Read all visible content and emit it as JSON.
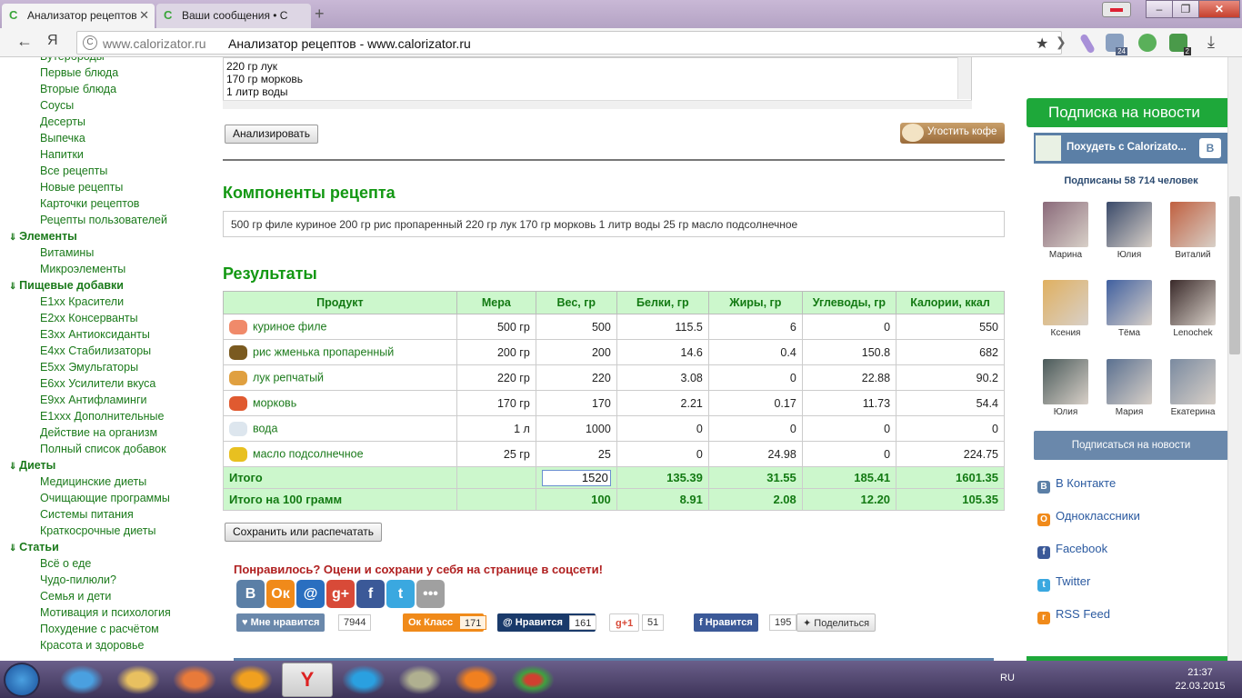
{
  "browser": {
    "tabs": [
      {
        "label": "Анализатор рецептов",
        "active": true
      },
      {
        "label": "Ваши сообщения • С",
        "active": false
      }
    ],
    "new_tab": "+",
    "back": "←",
    "yandex": "Я",
    "url": "www.calorizator.ru",
    "page_title": "Анализатор рецептов - www.calorizator.ru",
    "ext_badges": [
      "24",
      "2"
    ]
  },
  "sidebar": {
    "items": [
      {
        "label": "Бутерброды",
        "header": false
      },
      {
        "label": "Первые блюда",
        "header": false
      },
      {
        "label": "Вторые блюда",
        "header": false
      },
      {
        "label": "Соусы",
        "header": false
      },
      {
        "label": "Десерты",
        "header": false
      },
      {
        "label": "Выпечка",
        "header": false
      },
      {
        "label": "Напитки",
        "header": false
      },
      {
        "label": "Все рецепты",
        "header": false
      },
      {
        "label": "Новые рецепты",
        "header": false
      },
      {
        "label": "Карточки рецептов",
        "header": false
      },
      {
        "label": "Рецепты пользователей",
        "header": false
      },
      {
        "label": "Элементы",
        "header": true
      },
      {
        "label": "Витамины",
        "header": false
      },
      {
        "label": "Микроэлементы",
        "header": false
      },
      {
        "label": "Пищевые добавки",
        "header": true
      },
      {
        "label": "E1xx Красители",
        "header": false
      },
      {
        "label": "E2xx Консерванты",
        "header": false
      },
      {
        "label": "E3xx Антиоксиданты",
        "header": false
      },
      {
        "label": "E4xx Стабилизаторы",
        "header": false
      },
      {
        "label": "E5xx Эмульгаторы",
        "header": false
      },
      {
        "label": "E6xx Усилители вкуса",
        "header": false
      },
      {
        "label": "E9xx Антифламинги",
        "header": false
      },
      {
        "label": "E1xxx Дополнительные",
        "header": false
      },
      {
        "label": "Действие на организм",
        "header": false
      },
      {
        "label": "Полный список добавок",
        "header": false
      },
      {
        "label": "Диеты",
        "header": true
      },
      {
        "label": "Медицинские диеты",
        "header": false
      },
      {
        "label": "Очищающие программы",
        "header": false
      },
      {
        "label": "Системы питания",
        "header": false
      },
      {
        "label": "Краткосрочные диеты",
        "header": false
      },
      {
        "label": "Статьи",
        "header": true
      },
      {
        "label": "Всё о еде",
        "header": false
      },
      {
        "label": "Чудо-пилюли?",
        "header": false
      },
      {
        "label": "Семья и дети",
        "header": false
      },
      {
        "label": "Мотивация и психология",
        "header": false
      },
      {
        "label": "Похудение с расчётом",
        "header": false
      },
      {
        "label": "Красота и здоровье",
        "header": false
      }
    ]
  },
  "recipe_input": {
    "lines": [
      "220 гр лук",
      "170 гр морковь",
      "1 литр воды"
    ]
  },
  "buttons": {
    "analyze": "Анализировать",
    "coffee": "Угостить кофе",
    "save_print": "Сохранить или распечатать"
  },
  "components": {
    "heading": "Компоненты рецепта",
    "text": "500 гр филе куриное 200 гр рис пропаренный 220 гр лук 170 гр морковь 1 литр воды 25 гр масло подсолнечное"
  },
  "results": {
    "heading": "Результаты",
    "columns": [
      "Продукт",
      "Мера",
      "Вес, гр",
      "Белки, гр",
      "Жиры, гр",
      "Углеводы, гр",
      "Калории, ккал"
    ],
    "rows": [
      {
        "product": "куриное филе",
        "measure": "500 гр",
        "weight": "500",
        "protein": "115.5",
        "fat": "6",
        "carbs": "0",
        "kcal": "550",
        "icon_color": "#f08a6a"
      },
      {
        "product": "рис жменька пропаренный",
        "measure": "200 гр",
        "weight": "200",
        "protein": "14.6",
        "fat": "0.4",
        "carbs": "150.8",
        "kcal": "682",
        "icon_color": "#7a5a20"
      },
      {
        "product": "лук репчатый",
        "measure": "220 гр",
        "weight": "220",
        "protein": "3.08",
        "fat": "0",
        "carbs": "22.88",
        "kcal": "90.2",
        "icon_color": "#e0a040"
      },
      {
        "product": "морковь",
        "measure": "170 гр",
        "weight": "170",
        "protein": "2.21",
        "fat": "0.17",
        "carbs": "11.73",
        "kcal": "54.4",
        "icon_color": "#e05a30"
      },
      {
        "product": "вода",
        "measure": "1 л",
        "weight": "1000",
        "protein": "0",
        "fat": "0",
        "carbs": "0",
        "kcal": "0",
        "icon_color": "#dde6ee"
      },
      {
        "product": "масло подсолнечное",
        "measure": "25 гр",
        "weight": "25",
        "protein": "0",
        "fat": "24.98",
        "carbs": "0",
        "kcal": "224.75",
        "icon_color": "#e8c020"
      }
    ],
    "total": {
      "label": "Итого",
      "weight": "1520",
      "protein": "135.39",
      "fat": "31.55",
      "carbs": "185.41",
      "kcal": "1601.35"
    },
    "per100": {
      "label": "Итого на 100 грамм",
      "weight": "100",
      "protein": "8.91",
      "fat": "2.08",
      "carbs": "12.20",
      "kcal": "105.35"
    }
  },
  "share": {
    "prompt": "Понравилось? Оцени и сохрани у себя на странице в соцсети!",
    "icons": [
      {
        "glyph": "В",
        "color": "#5b7fa6"
      },
      {
        "glyph": "Ок",
        "color": "#f08a1a"
      },
      {
        "glyph": "@",
        "color": "#2a6fc0"
      },
      {
        "glyph": "g+",
        "color": "#d84a38"
      },
      {
        "glyph": "f",
        "color": "#3b5998"
      },
      {
        "glyph": "t",
        "color": "#3aa8e0"
      },
      {
        "glyph": "•••",
        "color": "#a0a0a0"
      }
    ],
    "vk_like": "Мне нравится",
    "vk_count": "7944",
    "ok_label": "Класс",
    "ok_count": "171",
    "mail_label": "Нравится",
    "mail_count": "161",
    "gplus_label": "+1",
    "gplus_count": "51",
    "fb_label": "Нравится",
    "fb_count": "195",
    "share_label": "Поделиться"
  },
  "right": {
    "subscribe_title": "Подписка на новости",
    "vk_group": "Похудеть с Calorizato...",
    "vk_logo": "В",
    "subscribers": "Подписаны 58 714 человек",
    "members": [
      {
        "name": "Марина",
        "color": "#8a6a7a"
      },
      {
        "name": "Юлия",
        "color": "#3a4a6a"
      },
      {
        "name": "Виталий",
        "color": "#c06040"
      },
      {
        "name": "Ксения",
        "color": "#e0b060"
      },
      {
        "name": "Тёма",
        "color": "#4060a0"
      },
      {
        "name": "Lenochek",
        "color": "#3a2a2a"
      },
      {
        "name": "Юлия",
        "color": "#4a5a5a"
      },
      {
        "name": "Мария",
        "color": "#5a7090"
      },
      {
        "name": "Екатерина",
        "color": "#7a8aa0"
      }
    ],
    "subscribe_btn": "Подписаться на новости",
    "links": [
      {
        "label": "В Контакте",
        "glyph": "В",
        "color": "#5b7fa6"
      },
      {
        "label": "Одноклассники",
        "glyph": "О",
        "color": "#f08a1a"
      },
      {
        "label": "Facebook",
        "glyph": "f",
        "color": "#3b5998"
      },
      {
        "label": "Twitter",
        "glyph": "t",
        "color": "#3aa8e0"
      },
      {
        "label": "RSS Feed",
        "glyph": "r",
        "color": "#f08a1a"
      }
    ]
  },
  "taskbar": {
    "lang": "RU",
    "time": "21:37",
    "date": "22.03.2015"
  }
}
